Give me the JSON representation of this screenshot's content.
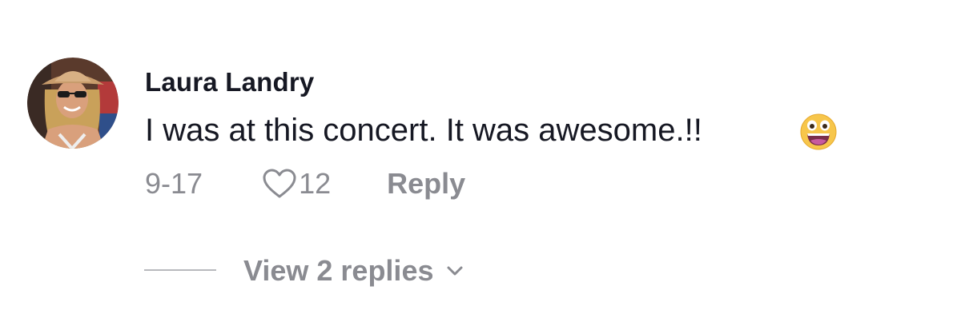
{
  "comment": {
    "username": "Laura Landry",
    "text": "I was at this concert. It was awesome.!!",
    "emoji": "grinning-face-emoji",
    "date": "9-17",
    "like_count": "12",
    "reply_label": "Reply"
  },
  "replies": {
    "label": "View 2 replies"
  },
  "icons": {
    "like": "heart-outline-icon",
    "expand": "chevron-down-icon"
  },
  "colors": {
    "primary_text": "#161823",
    "secondary_text": "#8a8b91",
    "background": "#ffffff",
    "emoji_face": "#f7c64b"
  }
}
